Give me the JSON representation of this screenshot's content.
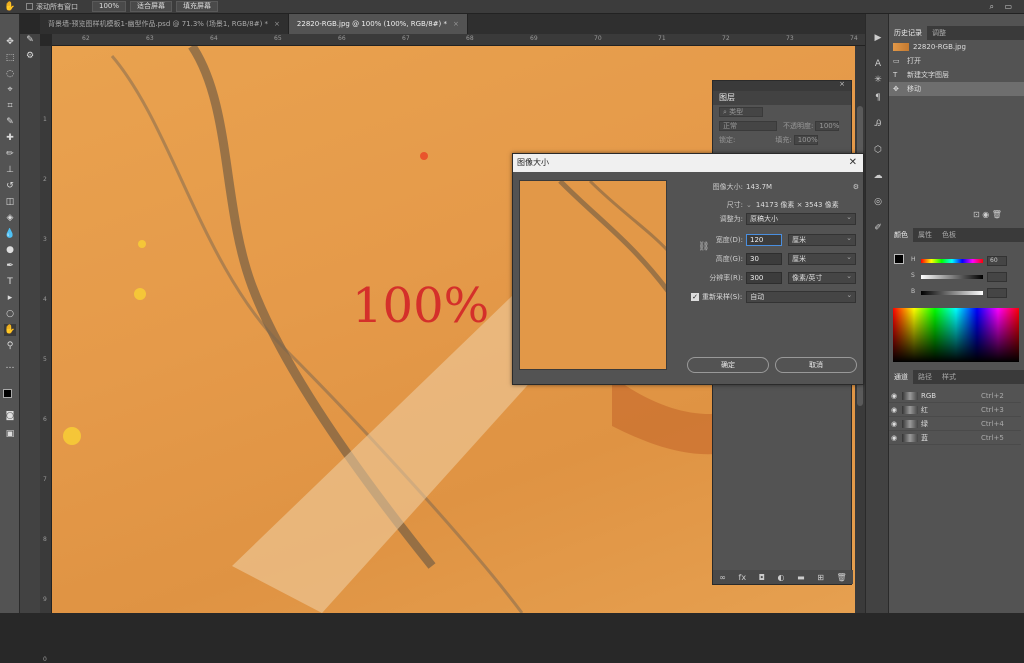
{
  "options_bar": {
    "scroll_all_label": "滚动所有窗口",
    "zoom_100": "100%",
    "fit_screen": "适合屏幕",
    "fill_screen": "填充屏幕"
  },
  "tabs": [
    {
      "label": "背景墙-预览图样机模板1-幽型作品.psd @ 71.3% (场景1, RGB/8#) *"
    },
    {
      "label": "22820-RGB.jpg @ 100% (100%, RGB/8#) *"
    }
  ],
  "ruler_h": [
    "62",
    "63",
    "64",
    "65",
    "66",
    "67",
    "68",
    "69",
    "70",
    "71",
    "72",
    "73",
    "74"
  ],
  "ruler_v": [
    "1",
    "2",
    "3",
    "4",
    "5",
    "6",
    "7",
    "8",
    "9",
    "0"
  ],
  "canvas": {
    "zoom_text": "100%"
  },
  "layers_panel": {
    "title": "图层",
    "filter_label": "类型",
    "blend_mode": "正常",
    "opacity_label": "不透明度:",
    "opacity_value": "100%",
    "lock_label": "锁定:",
    "fill_label": "填充:",
    "fill_value": "100%"
  },
  "dialog": {
    "title": "图像大小",
    "image_size_label": "图像大小:",
    "image_size_value": "143.7M",
    "dimensions_label": "尺寸:",
    "dimensions_value": "14173 像素 × 3543 像素",
    "fit_to_label": "调整为:",
    "fit_to_value": "原稿大小",
    "width_label": "宽度(D):",
    "width_value": "120",
    "width_unit": "厘米",
    "height_label": "高度(G):",
    "height_value": "30",
    "height_unit": "厘米",
    "resolution_label": "分辨率(R):",
    "resolution_value": "300",
    "resolution_unit": "像素/英寸",
    "resample_label": "重新采样(S):",
    "resample_value": "自动",
    "ok_label": "确定",
    "cancel_label": "取消"
  },
  "history_panel": {
    "tabs": [
      "历史记录",
      "调整"
    ],
    "snapshot": "22820-RGB.jpg",
    "items": [
      "打开",
      "新建文字图层",
      "移动"
    ]
  },
  "color_panel": {
    "tabs": [
      "颜色",
      "属性",
      "色板"
    ],
    "sliders": [
      {
        "label": "H",
        "value": "60"
      },
      {
        "label": "S",
        "value": ""
      },
      {
        "label": "B",
        "value": ""
      }
    ]
  },
  "channels_panel": {
    "tabs": [
      "通道",
      "路径",
      "样式"
    ],
    "rows": [
      {
        "name": "RGB",
        "shortcut": "Ctrl+2"
      },
      {
        "name": "红",
        "shortcut": "Ctrl+3"
      },
      {
        "name": "绿",
        "shortcut": "Ctrl+4"
      },
      {
        "name": "蓝",
        "shortcut": "Ctrl+5"
      }
    ]
  }
}
